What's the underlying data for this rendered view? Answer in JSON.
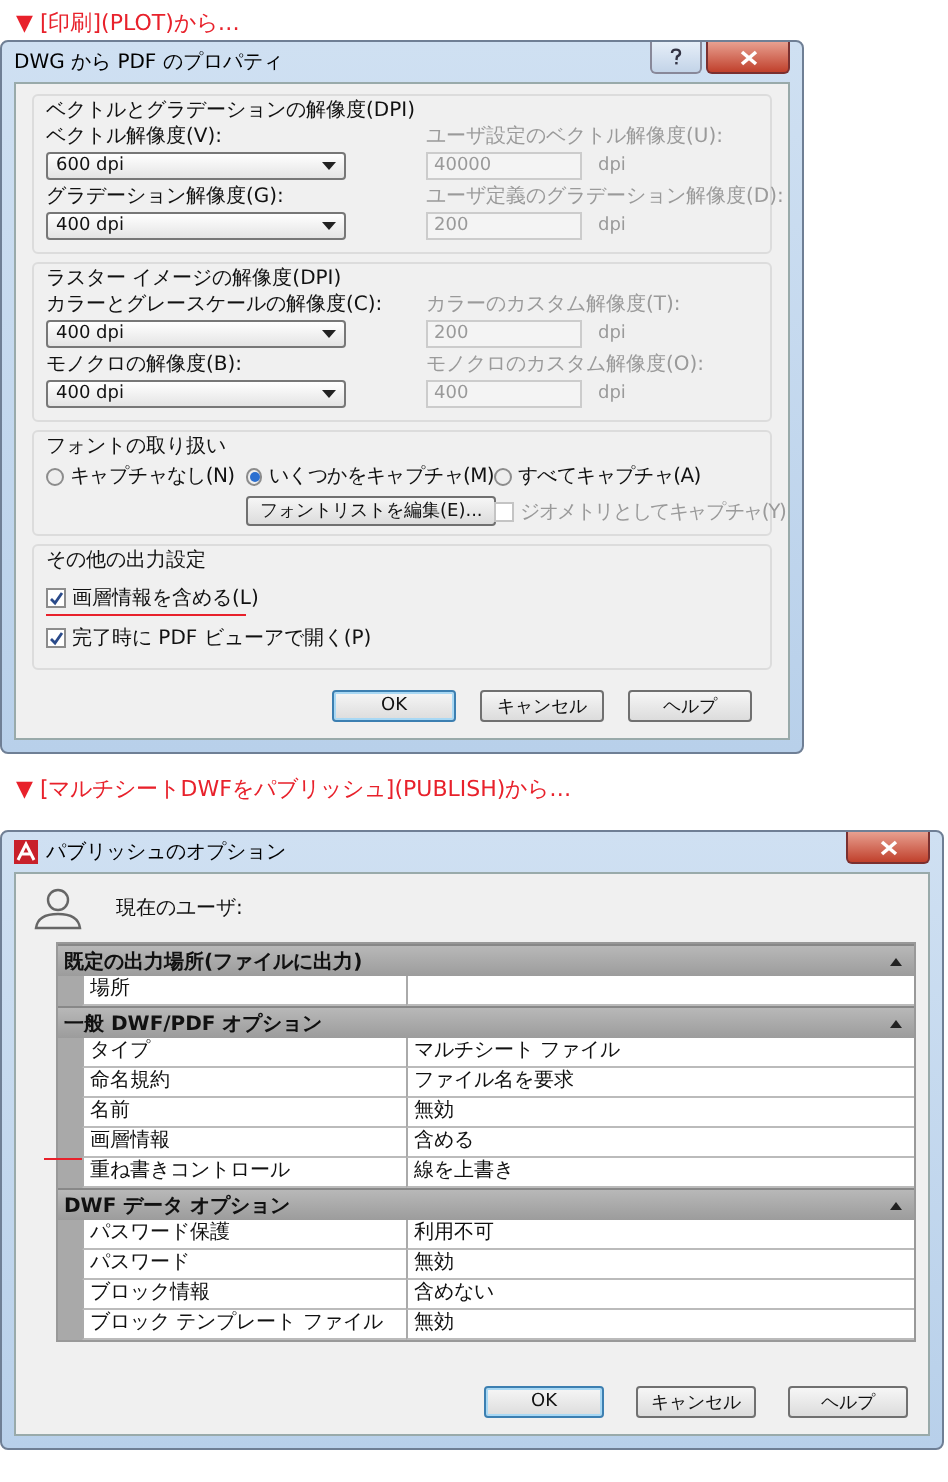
{
  "plot_caption": "▼ [印刷](PLOT)から…",
  "plot_dialog": {
    "title": "DWG から PDF のプロパティ",
    "resolution_groups": [
      {
        "title": "ベクトルとグラデーションの解像度(DPI)",
        "settings": [
          {
            "label": "ベクトル解像度(V):",
            "value": "600 dpi",
            "custom_label": "ユーザ設定のベクトル解像度(U):",
            "custom_value": "40000",
            "unit": "dpi",
            "custom_disabled": true
          },
          {
            "label": "グラデーション解像度(G):",
            "value": "400 dpi",
            "custom_label": "ユーザ定義のグラデーション解像度(D):",
            "custom_value": "200",
            "unit": "dpi",
            "custom_disabled": true
          }
        ]
      },
      {
        "title": "ラスター イメージの解像度(DPI)",
        "settings": [
          {
            "label": "カラーとグレースケールの解像度(C):",
            "value": "400 dpi",
            "custom_label": "カラーのカスタム解像度(T):",
            "custom_value": "200",
            "unit": "dpi",
            "custom_disabled": true
          },
          {
            "label": "モノクロの解像度(B):",
            "value": "400 dpi",
            "custom_label": "モノクロのカスタム解像度(O):",
            "custom_value": "400",
            "unit": "dpi",
            "custom_disabled": true
          }
        ]
      }
    ],
    "font_handling": {
      "title": "フォントの取り扱い",
      "options": [
        {
          "label": "キャプチャなし(N)",
          "selected": false
        },
        {
          "label": "いくつかをキャプチャ(M)",
          "selected": true
        },
        {
          "label": "すべてキャプチャ(A)",
          "selected": false
        }
      ],
      "edit_button": "フォントリストを編集(E)...",
      "geometry": {
        "label": "ジオメトリとしてキャプチャ(Y)",
        "checked": false,
        "disabled": true
      }
    },
    "other_output": {
      "title": "その他の出力設定",
      "checkboxes": [
        {
          "label": "画層情報を含める(L)",
          "checked": true,
          "highlighted": true
        },
        {
          "label": "完了時に PDF ビューアで開く(P)",
          "checked": true,
          "highlighted": false
        }
      ]
    },
    "buttons": [
      {
        "label": "OK",
        "default": true
      },
      {
        "label": "キャンセル",
        "default": false
      },
      {
        "label": "ヘルプ",
        "default": false
      }
    ]
  },
  "publish_caption": "▼ [マルチシートDWFをパブリッシュ](PUBLISH)から…",
  "publish_dialog": {
    "title": "パブリッシュのオプション",
    "user_label": "現在のユーザ:",
    "categories": [
      {
        "title": "既定の出力場所(ファイルに出力)",
        "expanded": true,
        "rows": [
          {
            "name": "場所",
            "value": "",
            "highlighted": false
          }
        ]
      },
      {
        "title": "一般 DWF/PDF オプション",
        "expanded": true,
        "rows": [
          {
            "name": "タイプ",
            "value": "マルチシート ファイル",
            "highlighted": false
          },
          {
            "name": "命名規約",
            "value": "ファイル名を要求",
            "highlighted": false
          },
          {
            "name": "名前",
            "value": "無効",
            "highlighted": false
          },
          {
            "name": "画層情報",
            "value": "含める",
            "highlighted": true
          },
          {
            "name": "重ね書きコントロール",
            "value": "線を上書き",
            "highlighted": false
          }
        ]
      },
      {
        "title": "DWF データ オプション",
        "expanded": true,
        "rows": [
          {
            "name": "パスワード保護",
            "value": "利用不可",
            "highlighted": false
          },
          {
            "name": "パスワード",
            "value": "無効",
            "highlighted": false
          },
          {
            "name": "ブロック情報",
            "value": "含めない",
            "highlighted": false
          },
          {
            "name": "ブロック テンプレート ファイル",
            "value": "無効",
            "highlighted": false
          }
        ]
      }
    ],
    "buttons": [
      {
        "label": "OK",
        "default": true
      },
      {
        "label": "キャンセル",
        "default": false
      },
      {
        "label": "ヘルプ",
        "default": false
      }
    ]
  }
}
